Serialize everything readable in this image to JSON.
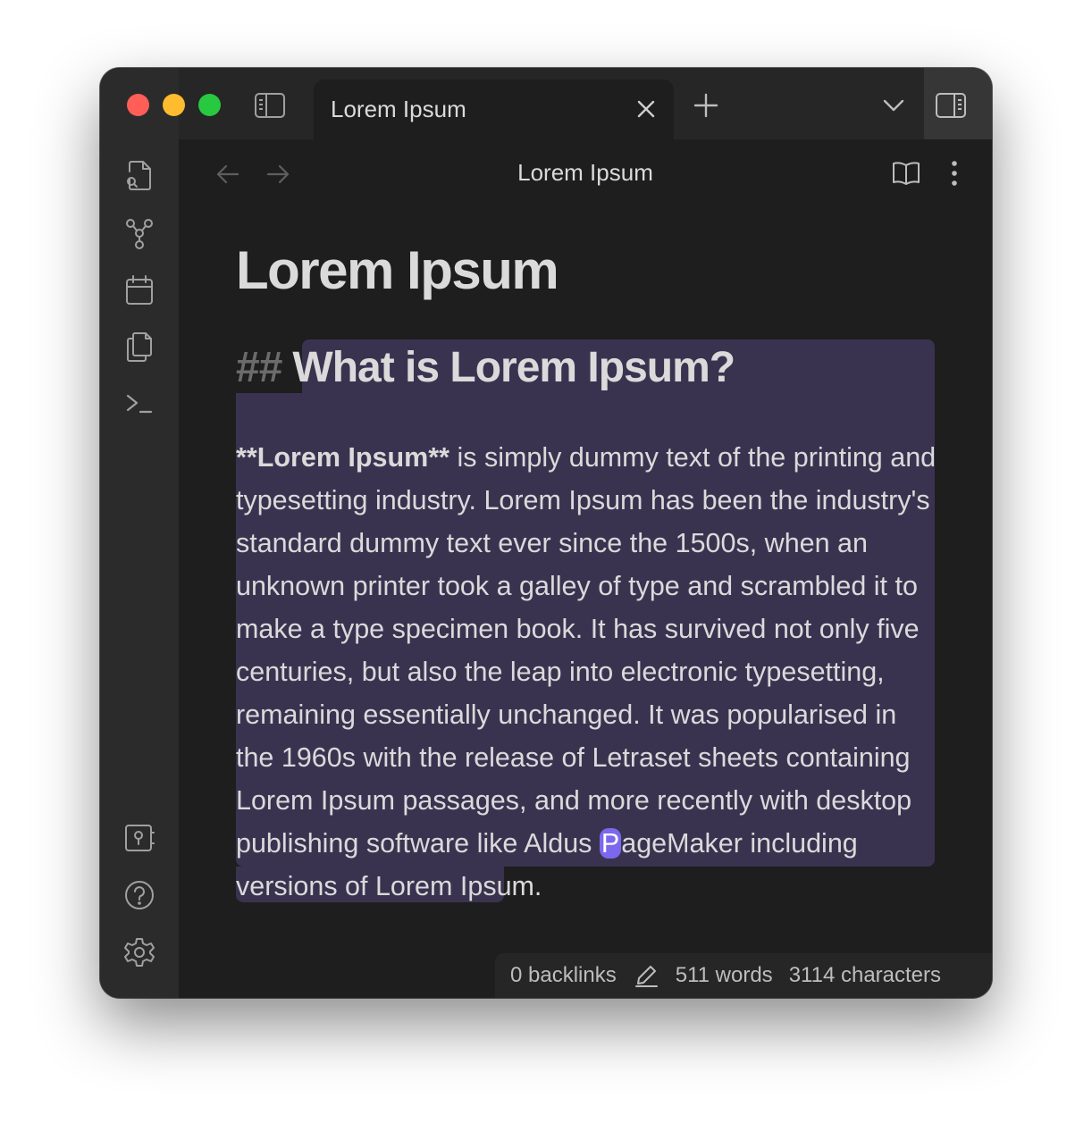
{
  "tab": {
    "title": "Lorem Ipsum"
  },
  "header": {
    "title": "Lorem Ipsum"
  },
  "note": {
    "h1": "Lorem Ipsum",
    "h2_marker": "##",
    "h2": "What is Lorem Ipsum?",
    "bold_text": "**Lorem Ipsum**",
    "para_part1": " is simply dummy text of the printing and typesetting industry. Lorem Ipsum has been the industry's standard dummy text ever since the 1500s, when an unknown printer took a galley of type and scrambled it to make a type specimen book. It has survived not only five centuries, but also the leap into electronic typesetting, remaining essentially unchanged. It was popularised in the 1960s with the release of Letraset sheets containing Lorem Ipsum passages, and more recently with desktop publishing software like Aldus ",
    "cursor_char": "P",
    "para_part2": "ageMaker including versions of Lorem Ipsum."
  },
  "status": {
    "backlinks": "0 backlinks",
    "words": "511 words",
    "characters": "3114 characters"
  },
  "icons": {
    "titlebar": [
      "left-sidebar-toggle-icon",
      "close-icon",
      "plus-icon",
      "chevron-down-icon",
      "right-sidebar-toggle-icon"
    ],
    "ribbon_top": [
      "search-file-icon",
      "graph-icon",
      "calendar-icon",
      "copy-icon",
      "terminal-icon"
    ],
    "ribbon_bottom": [
      "vault-icon",
      "help-icon",
      "settings-icon"
    ],
    "header": [
      "back-arrow-icon",
      "forward-arrow-icon",
      "reading-view-icon",
      "more-options-icon"
    ]
  },
  "colors": {
    "background": "#1e1e1e",
    "ribbon": "#2b2b2b",
    "selection": "#3a3350",
    "cursor": "#7b68ee",
    "traffic_red": "#ff5f57",
    "traffic_yellow": "#febc2e",
    "traffic_green": "#28c840"
  }
}
